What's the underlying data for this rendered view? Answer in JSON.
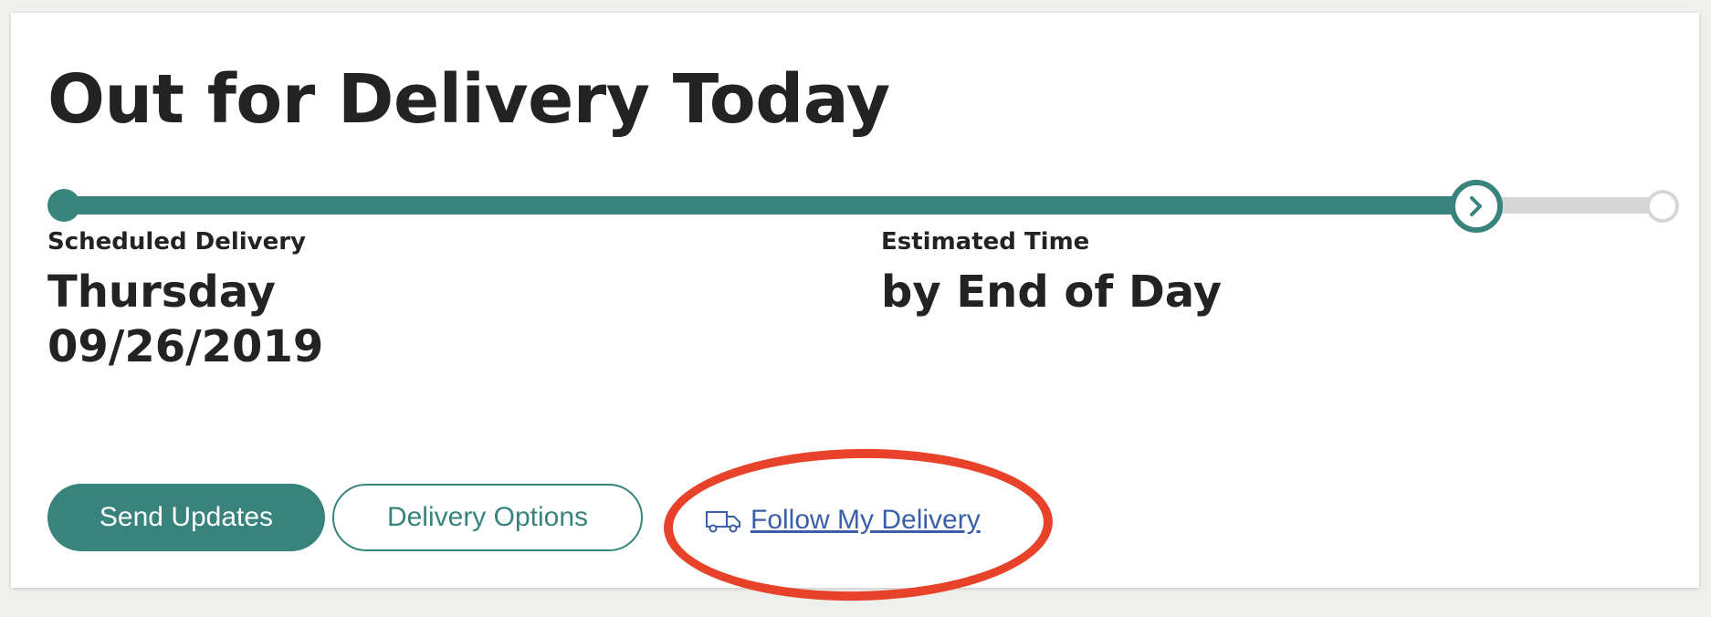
{
  "status": {
    "title": "Out for Delivery Today"
  },
  "progress": {
    "current_step": 2,
    "total_steps": 3,
    "fill_fraction": 0.87,
    "active_color": "#38837c",
    "inactive_color": "#d6d6d6",
    "current_marker_icon": "chevron-right-icon"
  },
  "scheduled": {
    "label": "Scheduled Delivery",
    "day": "Thursday",
    "date": "09/26/2019"
  },
  "estimated": {
    "label": "Estimated Time",
    "value": "by End of Day"
  },
  "actions": {
    "send_updates": "Send Updates",
    "delivery_options": "Delivery Options",
    "follow_my_delivery": "Follow My Delivery",
    "follow_icon": "truck-icon"
  },
  "annotation": {
    "color": "#e8432a",
    "shape": "ellipse"
  }
}
